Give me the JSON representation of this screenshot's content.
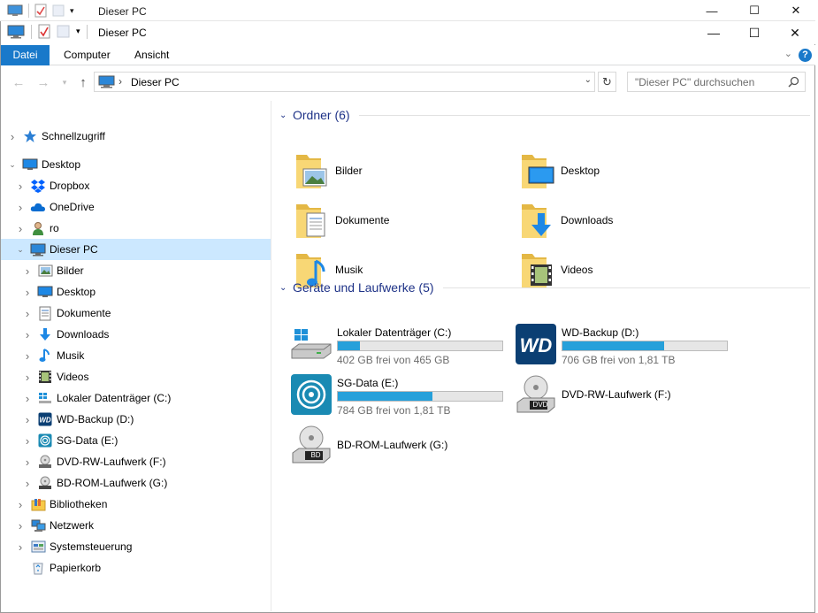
{
  "background_window": {
    "title": "Dieser PC"
  },
  "window": {
    "title": "Dieser PC",
    "controls": {
      "minimize": "—",
      "maximize": "☐",
      "close": "✕"
    }
  },
  "ribbon": {
    "tabs": [
      "Datei",
      "Computer",
      "Ansicht"
    ],
    "help": "?"
  },
  "address": {
    "path": "Dieser PC",
    "search_placeholder": "\"Dieser PC\" durchsuchen"
  },
  "nav_pane": {
    "items": [
      {
        "label": "Schnellzugriff",
        "icon": "star-icon",
        "level": 0,
        "expand": "collapsed"
      },
      {
        "label": "Desktop",
        "icon": "desktop-icon",
        "level": 0,
        "expand": "expanded"
      },
      {
        "label": "Dropbox",
        "icon": "dropbox-icon",
        "level": 1,
        "expand": "collapsed"
      },
      {
        "label": "OneDrive",
        "icon": "onedrive-icon",
        "level": 1,
        "expand": "collapsed"
      },
      {
        "label": "ro",
        "icon": "user-icon",
        "level": 1,
        "expand": "collapsed"
      },
      {
        "label": "Dieser PC",
        "icon": "computer-icon",
        "level": 1,
        "expand": "expanded",
        "selected": true
      },
      {
        "label": "Bilder",
        "icon": "pictures-icon",
        "level": 2,
        "expand": "collapsed"
      },
      {
        "label": "Desktop",
        "icon": "desktop-icon",
        "level": 2,
        "expand": "collapsed"
      },
      {
        "label": "Dokumente",
        "icon": "documents-icon",
        "level": 2,
        "expand": "collapsed"
      },
      {
        "label": "Downloads",
        "icon": "downloads-icon",
        "level": 2,
        "expand": "collapsed"
      },
      {
        "label": "Musik",
        "icon": "music-icon",
        "level": 2,
        "expand": "collapsed"
      },
      {
        "label": "Videos",
        "icon": "videos-icon",
        "level": 2,
        "expand": "collapsed"
      },
      {
        "label": "Lokaler Datenträger (C:)",
        "icon": "windows-drive-icon",
        "level": 2,
        "expand": "collapsed"
      },
      {
        "label": "WD-Backup (D:)",
        "icon": "wd-drive-icon",
        "level": 2,
        "expand": "collapsed"
      },
      {
        "label": "SG-Data (E:)",
        "icon": "seagate-drive-icon",
        "level": 2,
        "expand": "collapsed"
      },
      {
        "label": "DVD-RW-Laufwerk (F:)",
        "icon": "dvd-drive-icon",
        "level": 2,
        "expand": "collapsed"
      },
      {
        "label": "BD-ROM-Laufwerk (G:)",
        "icon": "bd-drive-icon",
        "level": 2,
        "expand": "collapsed"
      },
      {
        "label": "Bibliotheken",
        "icon": "libraries-icon",
        "level": 1,
        "expand": "collapsed"
      },
      {
        "label": "Netzwerk",
        "icon": "network-icon",
        "level": 1,
        "expand": "collapsed"
      },
      {
        "label": "Systemsteuerung",
        "icon": "control-panel-icon",
        "level": 1,
        "expand": "collapsed"
      },
      {
        "label": "Papierkorb",
        "icon": "recycle-bin-icon",
        "level": 1,
        "expand": "none"
      }
    ]
  },
  "content": {
    "folders_header": "Ordner (6)",
    "drives_header": "Geräte und Laufwerke (5)",
    "folders": [
      {
        "label": "Bilder",
        "icon": "pictures-folder-icon"
      },
      {
        "label": "Desktop",
        "icon": "desktop-folder-icon"
      },
      {
        "label": "Dokumente",
        "icon": "documents-folder-icon"
      },
      {
        "label": "Downloads",
        "icon": "downloads-folder-icon"
      },
      {
        "label": "Musik",
        "icon": "music-folder-icon"
      },
      {
        "label": "Videos",
        "icon": "videos-folder-icon"
      }
    ],
    "drives": [
      {
        "label": "Lokaler Datenträger (C:)",
        "icon": "windows-drive-icon",
        "free": "402 GB frei von 465 GB",
        "used_fraction": 0.135
      },
      {
        "label": "WD-Backup (D:)",
        "icon": "wd-drive-icon",
        "free": "706 GB frei von 1,81 TB",
        "used_fraction": 0.62
      },
      {
        "label": "SG-Data (E:)",
        "icon": "seagate-drive-icon",
        "free": "784 GB frei von 1,81 TB",
        "used_fraction": 0.575
      },
      {
        "label": "DVD-RW-Laufwerk (F:)",
        "icon": "dvd-drive-icon",
        "badge": "DVD"
      },
      {
        "label": "BD-ROM-Laufwerk (G:)",
        "icon": "bd-drive-icon",
        "badge": "BD"
      }
    ]
  },
  "colors": {
    "accent": "#1979ca",
    "selection": "#cce8ff",
    "progress": "#26a0da",
    "group_header": "#1e3287"
  }
}
